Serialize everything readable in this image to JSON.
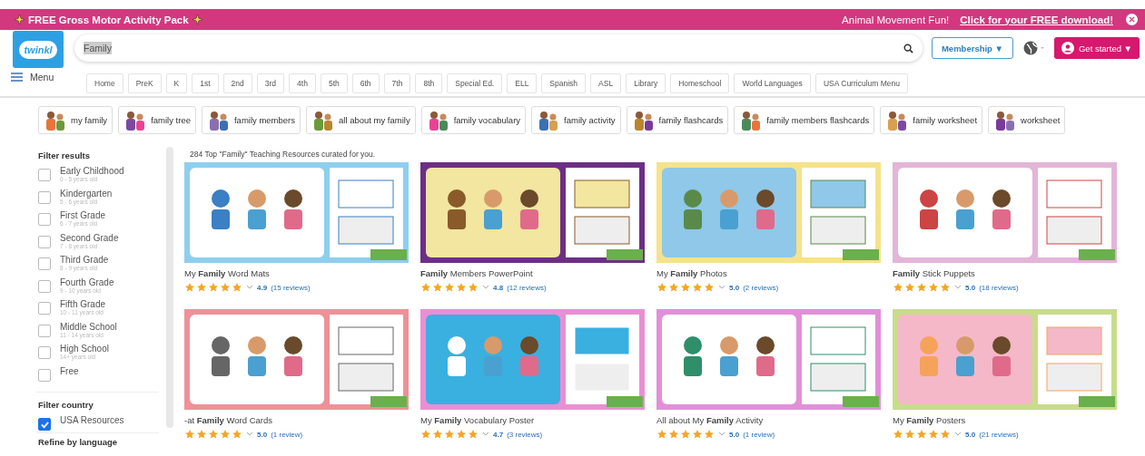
{
  "banner": {
    "promo": "FREE Gross Motor Activity Pack",
    "tagline": "Animal Movement Fun!",
    "link": "Click for your FREE download!"
  },
  "header": {
    "logo": "twinkl",
    "search": {
      "value": "Family"
    },
    "membership": "Membership ▼",
    "get_started": "Get started ▼"
  },
  "menu": "Menu",
  "nav_tabs": [
    "Home",
    "PreK",
    "K",
    "1st",
    "2nd",
    "3rd",
    "4th",
    "5th",
    "6th",
    "7th",
    "8th",
    "Special Ed.",
    "ELL",
    "Spanish",
    "ASL",
    "Library",
    "Homeschool",
    "World Languages",
    "USA Curriculum Menu"
  ],
  "topic_chips": [
    "my family",
    "family tree",
    "family members",
    "all about my family",
    "family vocabulary",
    "family activity",
    "family flashcards",
    "family members flashcards",
    "family worksheet",
    "worksheet"
  ],
  "filters": {
    "title": "Filter results",
    "items": [
      {
        "label": "Early Childhood",
        "sub": "0 - 5 years old",
        "checked": false
      },
      {
        "label": "Kindergarten",
        "sub": "5 - 6 years old",
        "checked": false
      },
      {
        "label": "First Grade",
        "sub": "6 - 7 years old",
        "checked": false
      },
      {
        "label": "Second Grade",
        "sub": "7 - 8 years old",
        "checked": false
      },
      {
        "label": "Third Grade",
        "sub": "8 - 9 years old",
        "checked": false
      },
      {
        "label": "Fourth Grade",
        "sub": "9 - 10 years old",
        "checked": false
      },
      {
        "label": "Fifth Grade",
        "sub": "10 - 11 years old",
        "checked": false
      },
      {
        "label": "Middle School",
        "sub": "11 - 14 years old",
        "checked": false
      },
      {
        "label": "High School",
        "sub": "14+ years old",
        "checked": false
      },
      {
        "label": "Free",
        "checked": false
      }
    ],
    "country_title": "Filter country",
    "country_items": [
      {
        "label": "USA Resources",
        "checked": true
      }
    ],
    "language_title": "Refine by language"
  },
  "results_summary": "284 Top \"Family\" Teaching Resources curated for you.",
  "resources": [
    {
      "title": "My **Family** Word Mats",
      "stars": 5,
      "rating": "4.9",
      "reviews": "(15 reviews)"
    },
    {
      "title": "**Family** Members PowerPoint",
      "stars": 5,
      "rating": "4.8",
      "reviews": "(12 reviews)"
    },
    {
      "title": "My **Family** Photos",
      "stars": 5,
      "rating": "5.0",
      "reviews": "(2 reviews)"
    },
    {
      "title": "**Family** Stick Puppets",
      "stars": 5,
      "rating": "5.0",
      "reviews": "(18 reviews)"
    },
    {
      "title": "-at **Family** Word Cards",
      "stars": 5,
      "rating": "5.0",
      "reviews": "(1 review)"
    },
    {
      "title": "My **Family** Vocabulary Poster",
      "stars": 5,
      "rating": "4.7",
      "reviews": "(3 reviews)"
    },
    {
      "title": "All about My **Family** Activity",
      "stars": 5,
      "rating": "5.0",
      "reviews": "(1 review)"
    },
    {
      "title": "My **Family** Posters",
      "stars": 5,
      "rating": "5.0",
      "reviews": "(21 reviews)"
    }
  ]
}
